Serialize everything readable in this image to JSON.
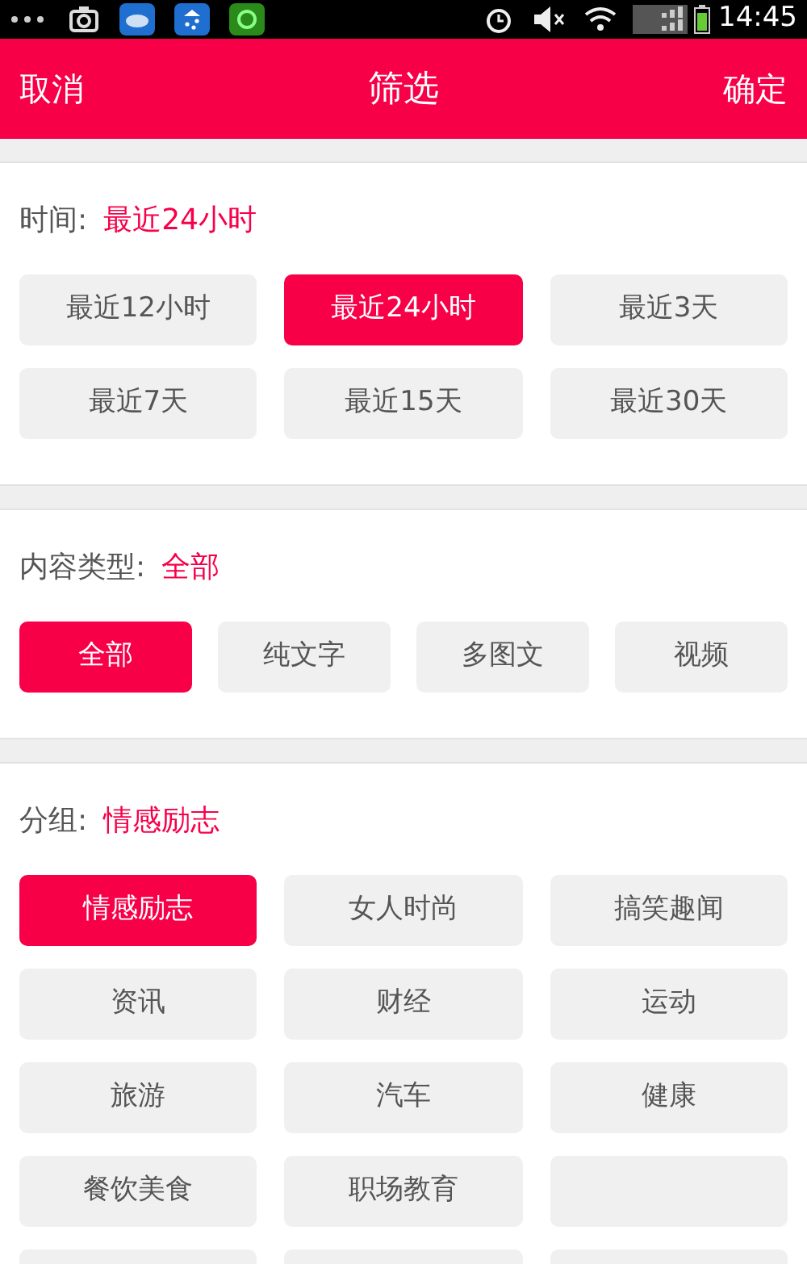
{
  "status_bar": {
    "time": "14:45"
  },
  "header": {
    "cancel": "取消",
    "title": "筛选",
    "confirm": "确定"
  },
  "sections": [
    {
      "label": "时间:",
      "value": "最近24小时",
      "options": [
        {
          "label": "最近12小时",
          "selected": false
        },
        {
          "label": "最近24小时",
          "selected": true
        },
        {
          "label": "最近3天",
          "selected": false
        },
        {
          "label": "最近7天",
          "selected": false
        },
        {
          "label": "最近15天",
          "selected": false
        },
        {
          "label": "最近30天",
          "selected": false
        }
      ]
    },
    {
      "label": "内容类型:",
      "value": "全部",
      "options": [
        {
          "label": "全部",
          "selected": true
        },
        {
          "label": "纯文字",
          "selected": false
        },
        {
          "label": "多图文",
          "selected": false
        },
        {
          "label": "视频",
          "selected": false
        }
      ]
    },
    {
      "label": "分组:",
      "value": "情感励志",
      "options": [
        {
          "label": "情感励志",
          "selected": true
        },
        {
          "label": "女人时尚",
          "selected": false
        },
        {
          "label": "搞笑趣闻",
          "selected": false
        },
        {
          "label": "资讯",
          "selected": false
        },
        {
          "label": "财经",
          "selected": false
        },
        {
          "label": "运动",
          "selected": false
        },
        {
          "label": "旅游",
          "selected": false
        },
        {
          "label": "汽车",
          "selected": false
        },
        {
          "label": "健康",
          "selected": false
        },
        {
          "label": "餐饮美食",
          "selected": false
        },
        {
          "label": "职场教育",
          "selected": false
        },
        {
          "selected": false
        },
        {
          "selected": false
        },
        {
          "selected": false
        },
        {
          "selected": false
        }
      ]
    }
  ]
}
